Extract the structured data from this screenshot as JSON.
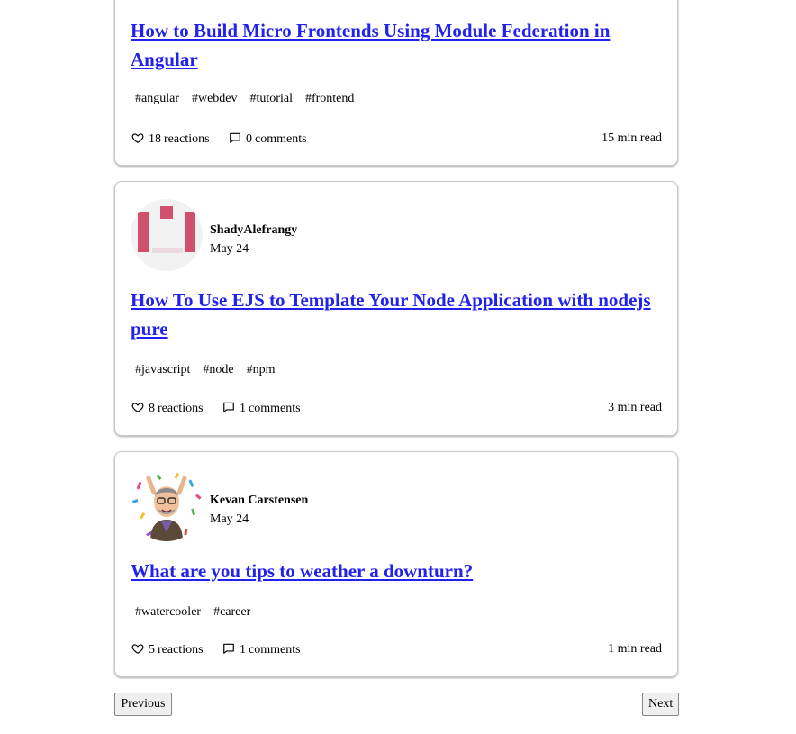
{
  "posts": [
    {
      "title": "How to Build Micro Frontends Using Module Federation in Angular",
      "tags": [
        "#angular",
        "#webdev",
        "#tutorial",
        "#frontend"
      ],
      "reactions": "18",
      "reactions_label": "reactions",
      "comments": "0",
      "comments_label": "comments",
      "read_time": "15 min read"
    },
    {
      "author": "ShadyAlefrangy",
      "date": "May 24",
      "title": "How To Use EJS to Template Your Node Application with nodejs pure",
      "tags": [
        "#javascript",
        "#node",
        "#npm"
      ],
      "reactions": "8",
      "reactions_label": "reactions",
      "comments": "1",
      "comments_label": "comments",
      "read_time": "3 min read"
    },
    {
      "author": "Kevan Carstensen",
      "date": "May 24",
      "title": "What are you tips to weather a downturn?",
      "tags": [
        "#watercooler",
        "#career"
      ],
      "reactions": "5",
      "reactions_label": "reactions",
      "comments": "1",
      "comments_label": "comments",
      "read_time": "1 min read"
    }
  ],
  "pagination": {
    "previous": "Previous",
    "next": "Next"
  },
  "icons": {
    "reactions": "heart-icon",
    "comments": "comment-icon"
  },
  "colors": {
    "link": "#2222ee",
    "avatar_pink": "#d0506e"
  }
}
